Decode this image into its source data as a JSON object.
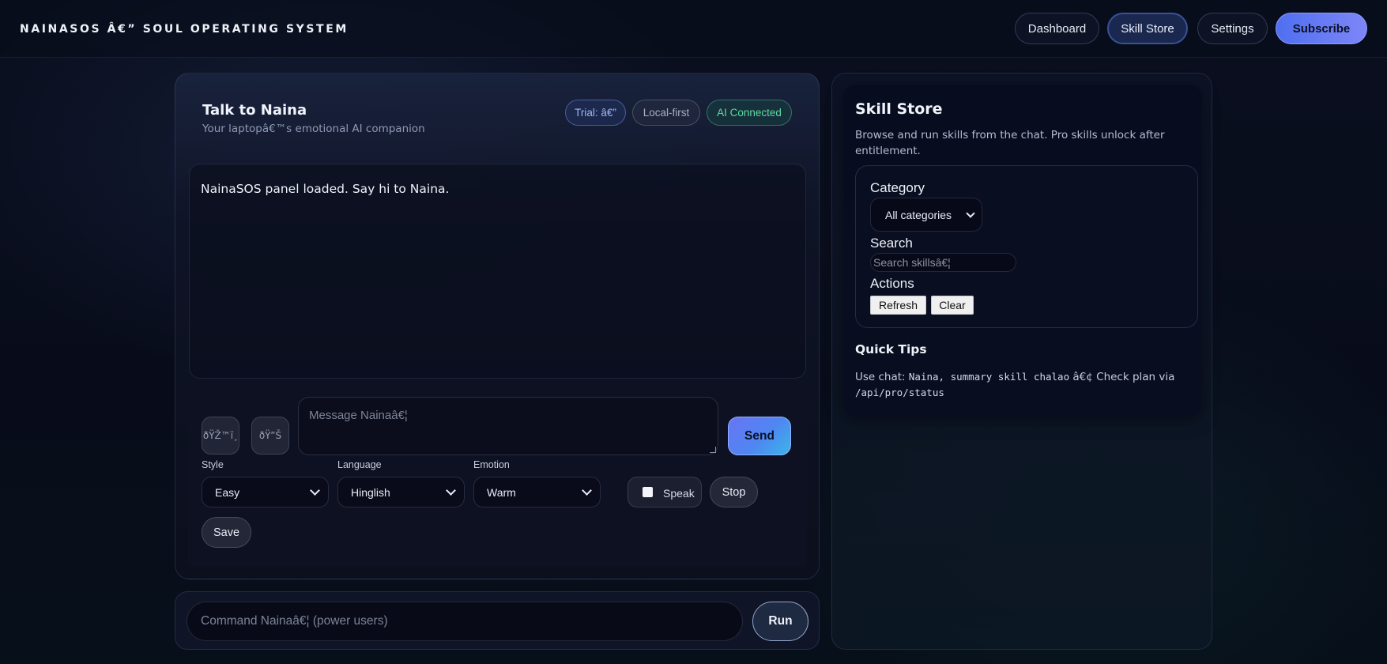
{
  "app": {
    "brand": "NAINASOS Â€” SOUL OPERATING SYSTEM"
  },
  "nav": {
    "dashboard": "Dashboard",
    "skill_store": "Skill Store",
    "settings": "Settings",
    "subscribe": "Subscribe",
    "active": "Skill Store"
  },
  "chat": {
    "title": "Talk to Naina",
    "subtitle": "Your laptopâ€™s emotional AI companion",
    "badges": {
      "trial": "Trial: â€”",
      "local": "Local-first",
      "ai": "AI Connected"
    },
    "log_message": "NainaSOS panel loaded. Say hi to Naina.",
    "mic_button": "ðŸŽ™ï¸",
    "voice_button": "ðŸ”Š",
    "message_placeholder": "Message Nainaâ€¦",
    "send_label": "Send",
    "style_label": "Style",
    "style_value": "Easy",
    "language_label": "Language",
    "language_value": "Hinglish",
    "emotion_label": "Emotion",
    "emotion_value": "Warm",
    "speak_label": "Speak",
    "stop_label": "Stop",
    "save_label": "Save"
  },
  "command": {
    "placeholder": "Command Nainaâ€¦ (power users)",
    "run_label": "Run"
  },
  "store": {
    "title": "Skill Store",
    "description": "Browse and run skills from the chat. Pro skills unlock after entitlement.",
    "category_label": "Category",
    "category_value": "All categories",
    "search_label": "Search",
    "search_placeholder": "Search skillsâ€¦",
    "actions_label": "Actions",
    "refresh_label": "Refresh",
    "clear_label": "Clear",
    "tips_title": "Quick Tips",
    "tips_prefix": "Use chat: ",
    "tips_code": "Naina, summary skill chalao",
    "tips_middle": " â€¢ Check plan via ",
    "tips_endpoint": "/api/pro/status"
  },
  "colors": {
    "accent": "#4f6ff0",
    "ai_connected": "#5fd9a6",
    "trial": "#9fb6f4"
  }
}
